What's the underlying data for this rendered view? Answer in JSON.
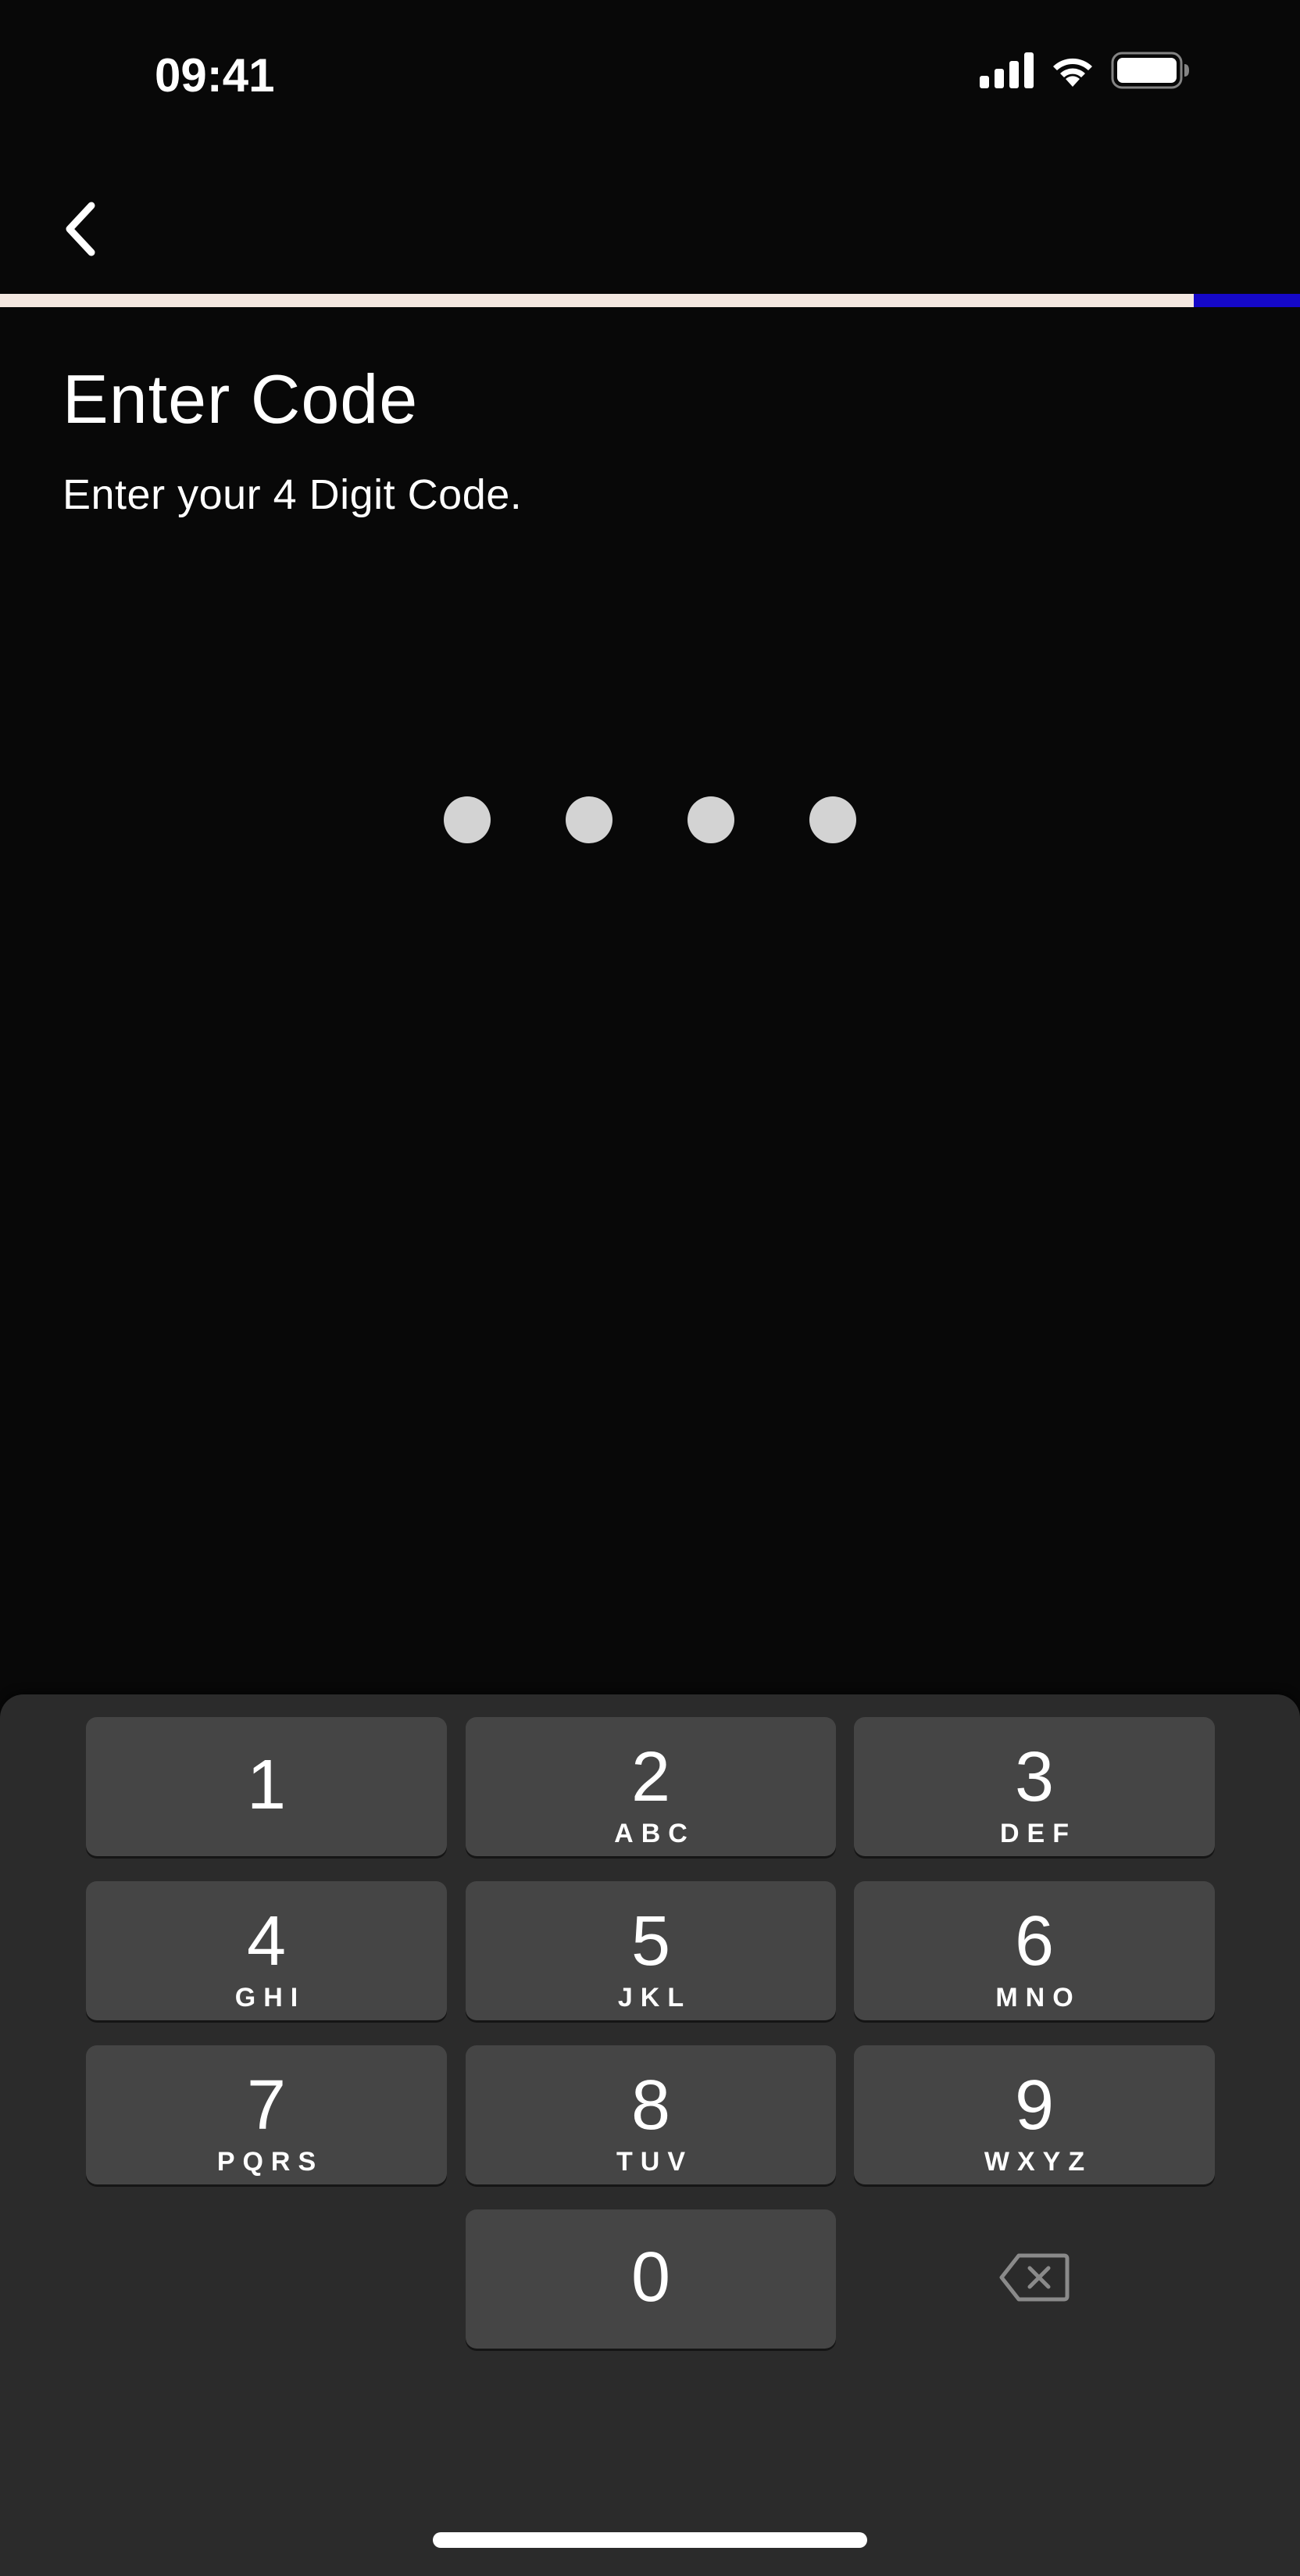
{
  "status_bar": {
    "time": "09:41",
    "icons": [
      "cellular-signal-icon",
      "wifi-icon",
      "battery-icon"
    ]
  },
  "nav": {
    "back_icon": "chevron-left-icon"
  },
  "progress": {
    "fraction": 0.918,
    "fill_color": "#f4e8e1",
    "track_color": "#1508c8"
  },
  "header": {
    "title": "Enter Code",
    "subtitle": "Enter your 4 Digit Code."
  },
  "code_input": {
    "length": 4,
    "filled": 0,
    "dot_color": "#d3d3d3"
  },
  "keypad": {
    "keys": [
      {
        "digit": "1",
        "letters": ""
      },
      {
        "digit": "2",
        "letters": "ABC"
      },
      {
        "digit": "3",
        "letters": "DEF"
      },
      {
        "digit": "4",
        "letters": "GHI"
      },
      {
        "digit": "5",
        "letters": "JKL"
      },
      {
        "digit": "6",
        "letters": "MNO"
      },
      {
        "digit": "7",
        "letters": "PQRS"
      },
      {
        "digit": "8",
        "letters": "TUV"
      },
      {
        "digit": "9",
        "letters": "WXYZ"
      },
      {
        "digit": "0",
        "letters": ""
      }
    ],
    "delete_icon": "backspace-icon"
  },
  "colors": {
    "background": "#080808",
    "keypad_background": "#2b2b2b",
    "key_background": "#454545"
  }
}
